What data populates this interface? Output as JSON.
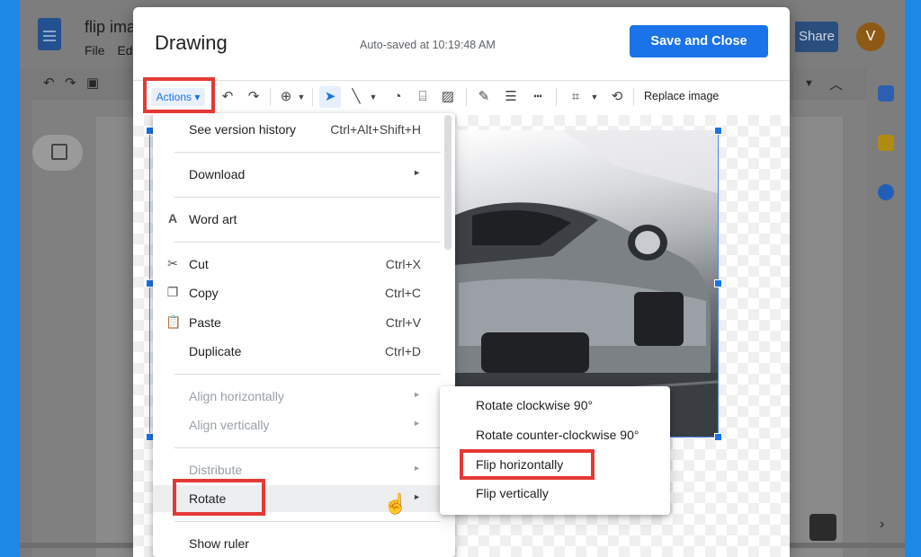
{
  "docs": {
    "title": "flip ima",
    "menu": [
      "File",
      "Ed"
    ],
    "share_label": "Share",
    "avatar_initial": "V"
  },
  "dialog": {
    "title": "Drawing",
    "autosave": "Auto-saved at 10:19:48 AM",
    "save_label": "Save and Close",
    "toolbar": {
      "actions_label": "Actions",
      "replace_label": "Replace image"
    }
  },
  "actions_menu": [
    {
      "label": "See version history",
      "shortcut": "Ctrl+Alt+Shift+H"
    },
    {
      "label": "Download"
    },
    {
      "label": "Word art"
    },
    {
      "label": "Cut",
      "shortcut": "Ctrl+X"
    },
    {
      "label": "Copy",
      "shortcut": "Ctrl+C"
    },
    {
      "label": "Paste",
      "shortcut": "Ctrl+V"
    },
    {
      "label": "Duplicate",
      "shortcut": "Ctrl+D"
    },
    {
      "label": "Align horizontally"
    },
    {
      "label": "Align vertically"
    },
    {
      "label": "Distribute"
    },
    {
      "label": "Rotate"
    },
    {
      "label": "Show ruler"
    }
  ],
  "rotate_submenu": [
    {
      "label": "Rotate clockwise 90°"
    },
    {
      "label": "Rotate counter-clockwise 90°"
    },
    {
      "label": "Flip horizontally"
    },
    {
      "label": "Flip vertically"
    }
  ],
  "colors": {
    "accent": "#1a73e8",
    "highlight_box": "#e53935"
  }
}
